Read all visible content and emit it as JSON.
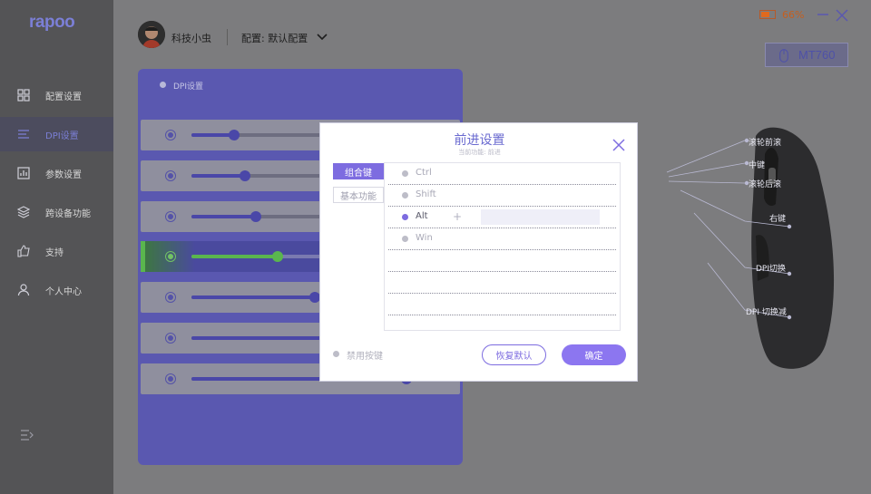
{
  "app": {
    "logo": "rapoo",
    "accent": "#7d6ce0"
  },
  "sidebar": {
    "items": [
      {
        "label": "配置设置",
        "icon": "grid-icon"
      },
      {
        "label": "DPI设置",
        "icon": "dpi-icon"
      },
      {
        "label": "参数设置",
        "icon": "chart-icon"
      },
      {
        "label": "跨设备功能",
        "icon": "layers-icon"
      },
      {
        "label": "支持",
        "icon": "thumbs-up-icon"
      },
      {
        "label": "个人中心",
        "icon": "person-icon"
      }
    ],
    "active_index": 1
  },
  "header": {
    "username": "科技小虫",
    "profile": "配置: 默认配置",
    "battery": "66%",
    "battery_level": 0.66,
    "device": "MT760"
  },
  "dpi_panel": {
    "title": "DPI设置",
    "rows": [
      {
        "fill": 0.16,
        "active": false
      },
      {
        "fill": 0.2,
        "active": false
      },
      {
        "fill": 0.24,
        "active": false
      },
      {
        "fill": 0.32,
        "active": true
      },
      {
        "fill": 0.46,
        "active": false
      },
      {
        "fill": 0.62,
        "active": false
      },
      {
        "fill": 0.8,
        "active": false
      }
    ]
  },
  "callouts": {
    "scroll_fwd": "滚轮前滚",
    "middle": "中键",
    "scroll_back": "滚轮后滚",
    "right": "右键",
    "dpi_up": "DPI切换",
    "dpi_down": "DPI 切换减"
  },
  "modal": {
    "title": "前进设置",
    "subtitle": "当前功能: 前进",
    "tab_combo": "组合键",
    "tab_basic": "基本功能",
    "keys": [
      {
        "name": "Ctrl",
        "on": false
      },
      {
        "name": "Shift",
        "on": false
      },
      {
        "name": "Alt",
        "on": true,
        "plus": "+",
        "value": ""
      },
      {
        "name": "Win",
        "on": false
      }
    ],
    "disable_label": "禁用按键",
    "reset_label": "恢复默认",
    "ok_label": "确定"
  }
}
